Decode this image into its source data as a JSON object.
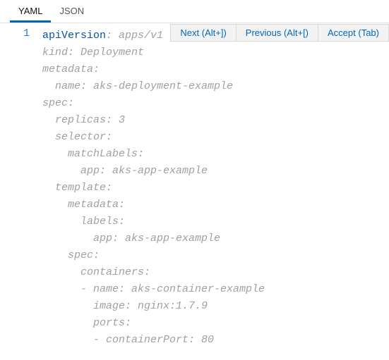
{
  "tabs": {
    "yaml": "YAML",
    "json": "JSON"
  },
  "suggest": {
    "next": "Next (Alt+])",
    "previous": "Previous (Alt+[)",
    "accept": "Accept (Tab)"
  },
  "gutter": {
    "line1": "1"
  },
  "code": {
    "l1_key": "apiVersion",
    "l1_colon": ": ",
    "l1_val": "apps/v1",
    "l2": "kind: Deployment",
    "l3": "metadata:",
    "l4": "  name: aks-deployment-example",
    "l5": "spec:",
    "l6": "  replicas: 3",
    "l7": "  selector:",
    "l8": "    matchLabels:",
    "l9": "      app: aks-app-example",
    "l10": "  template:",
    "l11": "    metadata:",
    "l12": "      labels:",
    "l13": "        app: aks-app-example",
    "l14": "    spec:",
    "l15": "      containers:",
    "l16": "      - name: aks-container-example",
    "l17": "        image: nginx:1.7.9",
    "l18": "        ports:",
    "l19": "        - containerPort: 80"
  }
}
